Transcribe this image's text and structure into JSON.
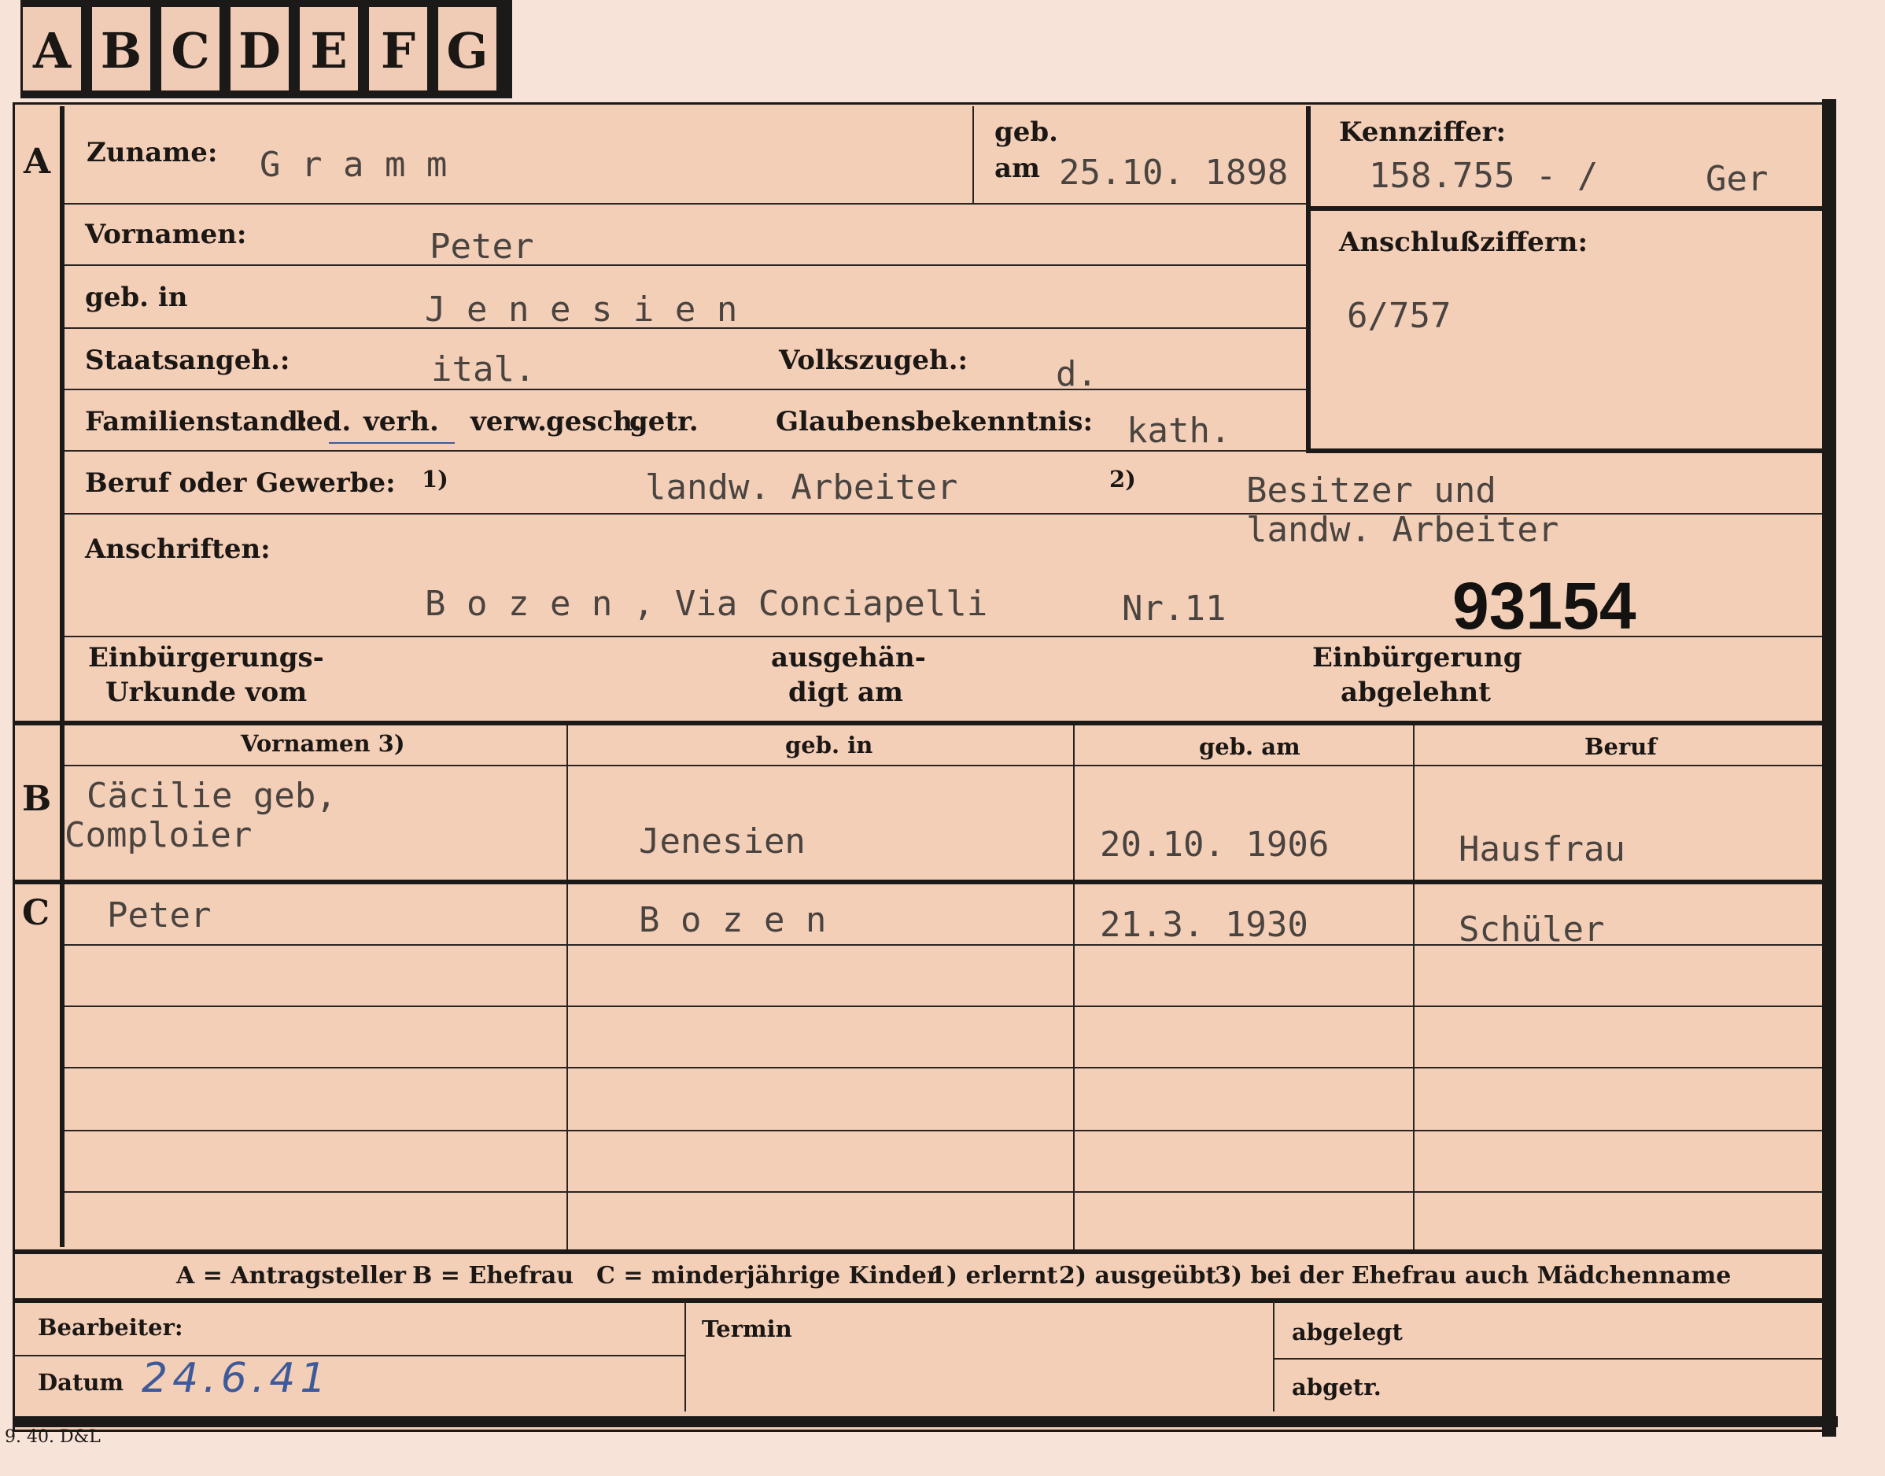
{
  "tabs": [
    "A",
    "B",
    "C",
    "D",
    "E",
    "F",
    "G"
  ],
  "sections": {
    "a": "A",
    "b": "B",
    "c": "C"
  },
  "labels": {
    "zuname": "Zuname:",
    "geb": "geb.",
    "am": "am",
    "kennziffer": "Kennziffer:",
    "vornamen": "Vornamen:",
    "anschluss": "Anschlußziffern:",
    "gebin": "geb. in",
    "staatsangeh": "Staatsangeh.:",
    "volkszugeh": "Volkszugeh.:",
    "familienstand": "Familienstand:",
    "fam_options": [
      "led.",
      "verh.",
      "verw.",
      "gesch.",
      "getr."
    ],
    "glaubens": "Glaubensbekenntnis:",
    "beruf": "Beruf oder Gewerbe:",
    "note1": "1)",
    "note2": "2)",
    "anschriften": "Anschriften:",
    "einb1": "Einbürgerungs-",
    "einb2": "Urkunde vom",
    "ausg1": "ausgehän-",
    "ausg2": "digt am",
    "einbg1": "Einbürgerung",
    "einbg2": "abgelehnt"
  },
  "applicant": {
    "zuname": "G r a m m",
    "geb_date": "25.10. 1898",
    "kennziffer": "158.755 - /",
    "kennziffer_suffix": "Ger",
    "vornamen": "Peter",
    "anschluss": "6/757",
    "gebin": "J e n e s i e n",
    "staatsangeh": "ital.",
    "volkszugeh": "d.",
    "glaubens": "kath.",
    "beruf1": "landw. Arbeiter",
    "beruf2_line1": "Besitzer und",
    "beruf2_line2": "landw. Arbeiter",
    "address": "B o z e n , Via Conciapelli",
    "address_nr": "Nr.11",
    "stamp_number": "93154"
  },
  "table": {
    "headers": [
      "Vornamen 3)",
      "geb. in",
      "geb. am",
      "Beruf"
    ],
    "wife": {
      "name1": "Cäcilie  geb,",
      "name2": "Comploier",
      "gebin": "Jenesien",
      "gebam": "20.10. 1906",
      "beruf": "Hausfrau"
    },
    "child": {
      "name": "Peter",
      "gebin": "B o z e n",
      "gebam": "21.3. 1930",
      "beruf": "Schüler"
    }
  },
  "legend": {
    "a": "A = Antragsteller",
    "b": "B = Ehefrau",
    "c": "C = minderjährige Kinder",
    "n1": "1) erlernt",
    "n2": "2) ausgeübt",
    "n3": "3) bei der Ehefrau auch Mädchenname"
  },
  "bottom": {
    "bearbeiter": "Bearbeiter:",
    "datum": "Datum",
    "datum_value": "24.6.41",
    "termin": "Termin",
    "abgelegt": "abgelegt",
    "abgetr": "abgetr."
  },
  "footer": "9. 40. D&L"
}
